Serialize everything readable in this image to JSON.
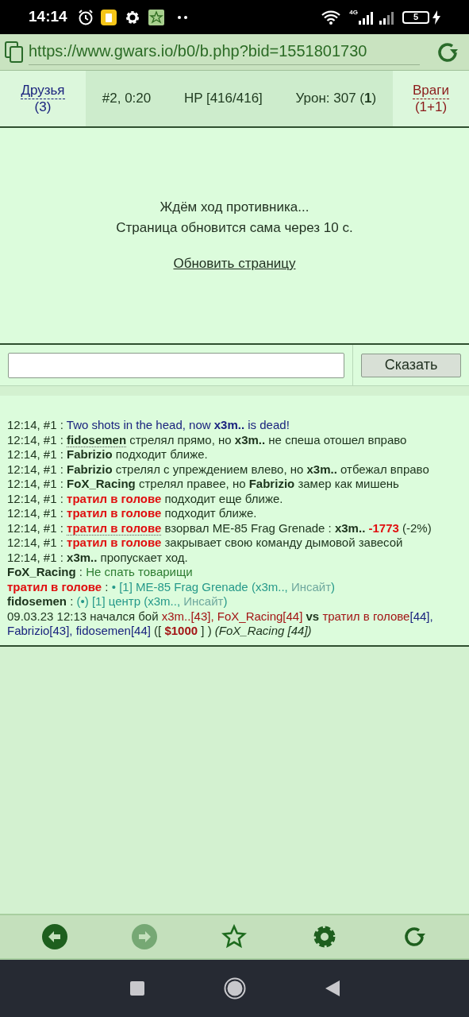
{
  "status_bar": {
    "time": "14:14",
    "network": "4G",
    "battery": "5"
  },
  "address_bar": {
    "url": "https://www.gwars.io/b0/b.php?bid=1551801730"
  },
  "battle_header": {
    "friends": {
      "label": "Друзья",
      "count": "(3)"
    },
    "turn": "#2, 0:20",
    "hp": "HP [416/416]",
    "damage": "Урон: 307 (**1**)",
    "enemies": {
      "label": "Враги",
      "count": "(1+1)"
    }
  },
  "wait_panel": {
    "lines": [
      "Ждём ход противника...",
      "Страница обновится сама через 10 с."
    ],
    "refresh_link": "Обновить страницу"
  },
  "chat": {
    "say_button": "Сказать"
  },
  "log": [
    [
      {
        "kind": "plain",
        "text": "12:14, #1 : "
      },
      {
        "kind": "blue",
        "text": "Two shots in the head, now "
      },
      {
        "kind": "bluebold",
        "text": "x3m.."
      },
      {
        "kind": "blue",
        "text": " is dead!"
      }
    ],
    [
      {
        "kind": "plain",
        "text": "12:14, #1 : "
      },
      {
        "kind": "bold",
        "text": "fidosemen",
        "dotted": true
      },
      {
        "kind": "plain",
        "text": " стрелял прямо, но "
      },
      {
        "kind": "bold",
        "text": "x3m.."
      },
      {
        "kind": "plain",
        "text": " не спеша отошел вправо"
      }
    ],
    [
      {
        "kind": "plain",
        "text": "12:14, #1 : "
      },
      {
        "kind": "bold",
        "text": "Fabrizio"
      },
      {
        "kind": "plain",
        "text": " подходит ближе."
      }
    ],
    [
      {
        "kind": "plain",
        "text": "12:14, #1 : "
      },
      {
        "kind": "bold",
        "text": "Fabrizio"
      },
      {
        "kind": "plain",
        "text": " стрелял с упреждением влево, но "
      },
      {
        "kind": "bold",
        "text": "x3m.."
      },
      {
        "kind": "plain",
        "text": " отбежал вправо"
      }
    ],
    [
      {
        "kind": "plain",
        "text": "12:14, #1 : "
      },
      {
        "kind": "bold",
        "text": "FoX_Racing"
      },
      {
        "kind": "plain",
        "text": " стрелял правее, но "
      },
      {
        "kind": "bold",
        "text": "Fabrizio"
      },
      {
        "kind": "plain",
        "text": " замер как мишень"
      }
    ],
    [
      {
        "kind": "plain",
        "text": "12:14, #1 : "
      },
      {
        "kind": "enemy",
        "text": "тратил в голове"
      },
      {
        "kind": "plain",
        "text": " подходит еще ближе."
      }
    ],
    [
      {
        "kind": "plain",
        "text": "12:14, #1 : "
      },
      {
        "kind": "enemy",
        "text": "тратил в голове"
      },
      {
        "kind": "plain",
        "text": " подходит ближе."
      }
    ],
    [
      {
        "kind": "plain",
        "text": "12:14, #1 : "
      },
      {
        "kind": "enemy",
        "text": "тратил в голове",
        "dotted": true
      },
      {
        "kind": "plain",
        "text": " взорвал ME-85 Frag Grenade : "
      },
      {
        "kind": "bold",
        "text": "x3m.. "
      },
      {
        "kind": "enemy",
        "text": "-1773"
      },
      {
        "kind": "plain",
        "text": " (-2%)"
      }
    ],
    [
      {
        "kind": "plain",
        "text": "12:14, #1 : "
      },
      {
        "kind": "enemy",
        "text": "тратил в голове"
      },
      {
        "kind": "plain",
        "text": " закрывает свою команду дымовой завесой"
      }
    ],
    [
      {
        "kind": "plain",
        "text": "12:14, #1 : "
      },
      {
        "kind": "bold",
        "text": "x3m.."
      },
      {
        "kind": "plain",
        "text": " пропускает ход."
      }
    ],
    [
      {
        "kind": "bold",
        "text": "FoX_Racing"
      },
      {
        "kind": "plain",
        "text": " : "
      },
      {
        "kind": "chat",
        "text": "Не спать товарищи"
      }
    ],
    [
      {
        "kind": "enemy",
        "text": "тратил в голове"
      },
      {
        "kind": "plain",
        "text": " : "
      },
      {
        "kind": "teal",
        "text": "• [1] ME-85 Frag Grenade (x3m.., "
      },
      {
        "kind": "muted",
        "text": "Инсайт"
      },
      {
        "kind": "teal",
        "text": ")"
      }
    ],
    [
      {
        "kind": "bold",
        "text": "fidosemen"
      },
      {
        "kind": "plain",
        "text": " : "
      },
      {
        "kind": "teal",
        "text": "(•) [1] центр (x3m.., "
      },
      {
        "kind": "muted",
        "text": "Инсайт"
      },
      {
        "kind": "teal",
        "text": ")"
      }
    ],
    [
      {
        "kind": "plain",
        "text": "09.03.23 12:13 начался бой "
      },
      {
        "kind": "darkred",
        "text": "x3m..[43], FoX_Racing[44]"
      },
      {
        "kind": "bold",
        "text": " vs "
      },
      {
        "kind": "darkred",
        "text": "тратил в голове"
      },
      {
        "kind": "navy",
        "text": "[44], Fabrizio[43], fidosemen[44]"
      },
      {
        "kind": "plain",
        "text": " ([ "
      },
      {
        "kind": "money",
        "text": "$1000"
      },
      {
        "kind": "plain",
        "text": " ] ) "
      },
      {
        "kind": "italic",
        "text": "(FoX_Racing [44])"
      }
    ]
  ],
  "bottom_toolbar": {
    "back_enabled": true,
    "forward_enabled": false
  }
}
